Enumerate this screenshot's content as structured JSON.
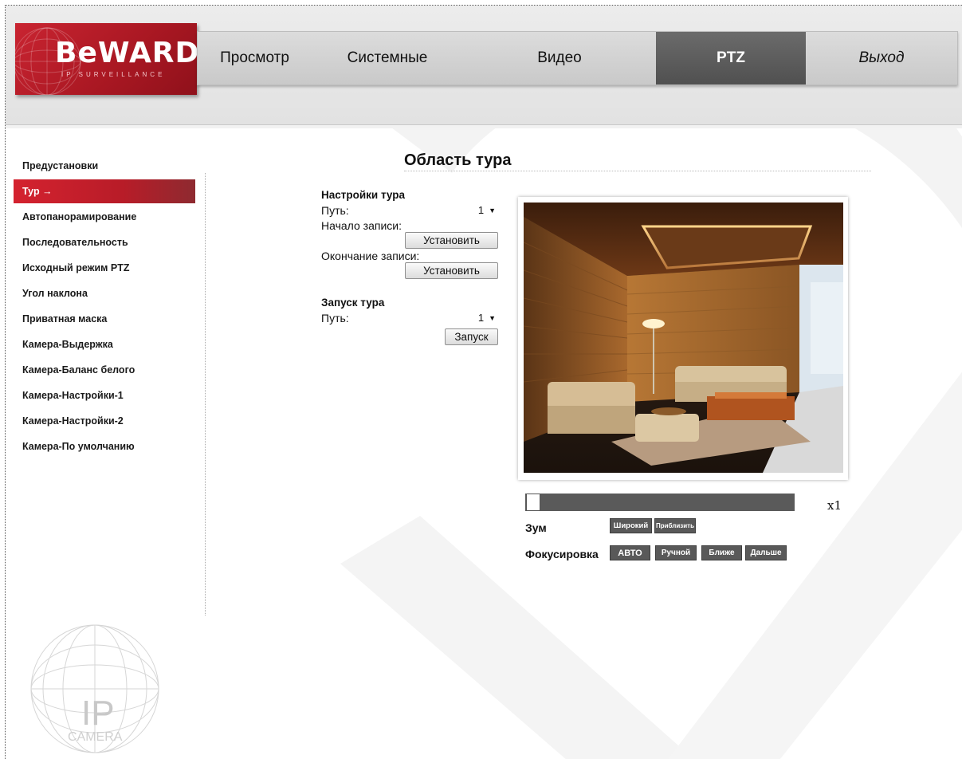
{
  "brand": {
    "logo_text": "BeWARD",
    "logo_sub": "IP SURVEILLANCE",
    "red": "#c92431"
  },
  "topnav": {
    "tabs": [
      {
        "label": "Просмотр"
      },
      {
        "label": "Системные"
      },
      {
        "label": "Видео"
      },
      {
        "label": "PTZ",
        "active": true
      },
      {
        "label": "Выход"
      }
    ]
  },
  "sidebar": {
    "items": [
      {
        "label": "Предустановки"
      },
      {
        "label": "Тур →",
        "active": true
      },
      {
        "label": "Автопанорамирование"
      },
      {
        "label": "Последовательность"
      },
      {
        "label": "Исходный режим PTZ"
      },
      {
        "label": "Угол наклона"
      },
      {
        "label": "Приватная маска"
      },
      {
        "label": "Камера-Выдержка"
      },
      {
        "label": "Камера-Баланс белого"
      },
      {
        "label": "Камера-Настройки-1"
      },
      {
        "label": "Камера-Настройки-2"
      },
      {
        "label": "Камера-По умолчанию"
      }
    ]
  },
  "watermark": {
    "text_ip": "IP",
    "text_camera": "CAMERA"
  },
  "main": {
    "title": "Область тура",
    "tour_settings": {
      "title": "Настройки тура",
      "path_label": "Путь:",
      "path_value": "1",
      "start_label": "Начало записи:",
      "start_button": "Установить",
      "end_label": "Окончание записи:",
      "end_button": "Установить"
    },
    "tour_run": {
      "title": "Запуск тура",
      "path_label": "Путь:",
      "path_value": "1",
      "run_button": "Запуск"
    }
  },
  "controls": {
    "zoom_level": "x1",
    "zoom_position": 0,
    "zoom_label": "Зум",
    "zoom_wide": "Широкий",
    "zoom_tele": "Приблизить",
    "focus_label": "Фокусировка",
    "focus_auto": "АВТО",
    "focus_manual": "Ручной",
    "focus_near": "Ближе",
    "focus_far": "Дальше"
  }
}
